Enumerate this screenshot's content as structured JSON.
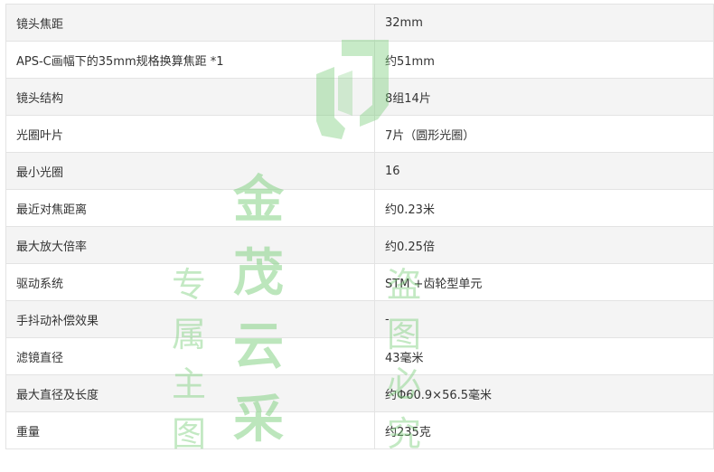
{
  "specs": [
    {
      "label": "镜头焦距",
      "value": "32mm"
    },
    {
      "label": "APS-C画幅下的35mm规格换算焦距 *1",
      "value": "约51mm"
    },
    {
      "label": "镜头结构",
      "value": "8组14片"
    },
    {
      "label": "光圈叶片",
      "value": "7片（圆形光圈）"
    },
    {
      "label": "最小光圈",
      "value": "16"
    },
    {
      "label": "最近对焦距离",
      "value": "约0.23米"
    },
    {
      "label": "最大放大倍率",
      "value": "约0.25倍"
    },
    {
      "label": "驱动系统",
      "value": "STM +齿轮型单元"
    },
    {
      "label": "手抖动补偿效果",
      "value": "-"
    },
    {
      "label": "滤镜直径",
      "value": "43毫米"
    },
    {
      "label": "最大直径及长度",
      "value": "约Φ60.9×56.5毫米"
    },
    {
      "label": "重量",
      "value": "约235克"
    }
  ],
  "watermark": {
    "title": "金茂云采",
    "subtitle_left": "专属主图",
    "subtitle_right": "盗图必究",
    "color": "#7ace7a"
  }
}
